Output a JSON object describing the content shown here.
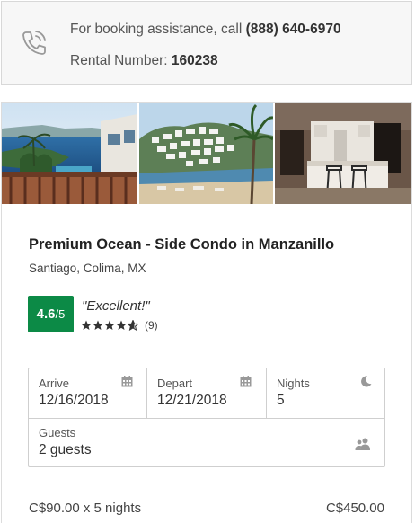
{
  "assistance": {
    "prefix": "For booking assistance, call ",
    "phone": "(888) 640-6970",
    "rental_label": "Rental Number: ",
    "rental_number": "160238",
    "icon": "phone-icon"
  },
  "photos": [
    {
      "name": "photo-ocean-balcony"
    },
    {
      "name": "photo-beach-hillside"
    },
    {
      "name": "photo-kitchen-interior"
    }
  ],
  "listing": {
    "title": "Premium Ocean - Side Condo in Manzanillo",
    "location": "Santiago, Colima, MX"
  },
  "rating": {
    "score": "4.6",
    "out_of": "/5",
    "label": "\"Excellent!\"",
    "stars": 4.6,
    "review_count": "(9)",
    "badge_color": "#0c8a46"
  },
  "booking": {
    "arrive_label": "Arrive",
    "arrive_value": "12/16/2018",
    "depart_label": "Depart",
    "depart_value": "12/21/2018",
    "nights_label": "Nights",
    "nights_value": "5",
    "guests_label": "Guests",
    "guests_value": "2 guests",
    "icons": {
      "arrive": "calendar-icon",
      "depart": "calendar-icon",
      "nights": "moon-icon",
      "guests": "guests-icon"
    }
  },
  "pricing": {
    "line": "C$90.00 x 5 nights",
    "total": "C$450.00"
  }
}
